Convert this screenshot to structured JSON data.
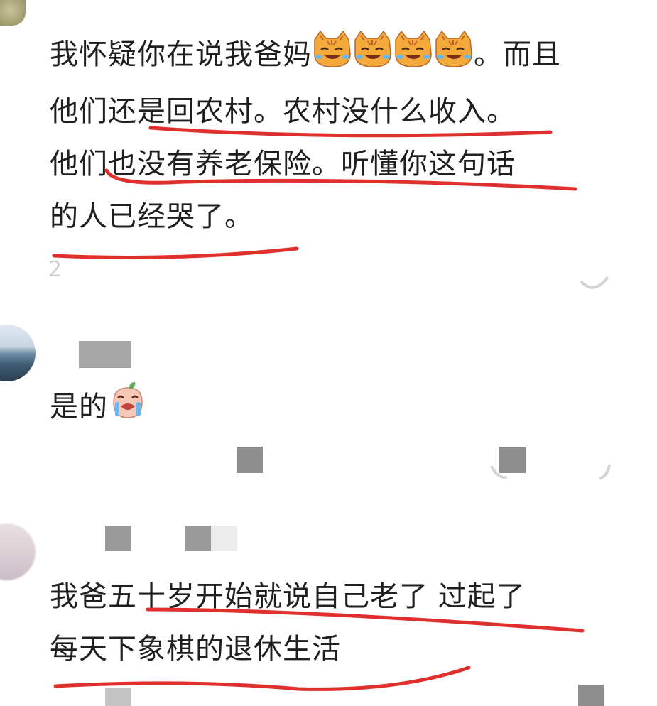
{
  "comments": [
    {
      "lines": [
        "我怀疑你在说我爸妈",
        "。而且",
        "他们还是回农村。农村没什么收入。",
        "他们也没有养老保险。听懂你这句话",
        "的人已经哭了。"
      ],
      "emoji": "crying-cat-emoji"
    },
    {
      "text": "是的",
      "emoji": "crying-peach-emoji"
    },
    {
      "lines": [
        "我爸五十岁开始就说自己老了 过起了",
        "每天下象棋的退休生活"
      ]
    }
  ],
  "colors": {
    "text": "#1f1f1f",
    "underline": "#e0302e",
    "background": "#ffffff"
  }
}
